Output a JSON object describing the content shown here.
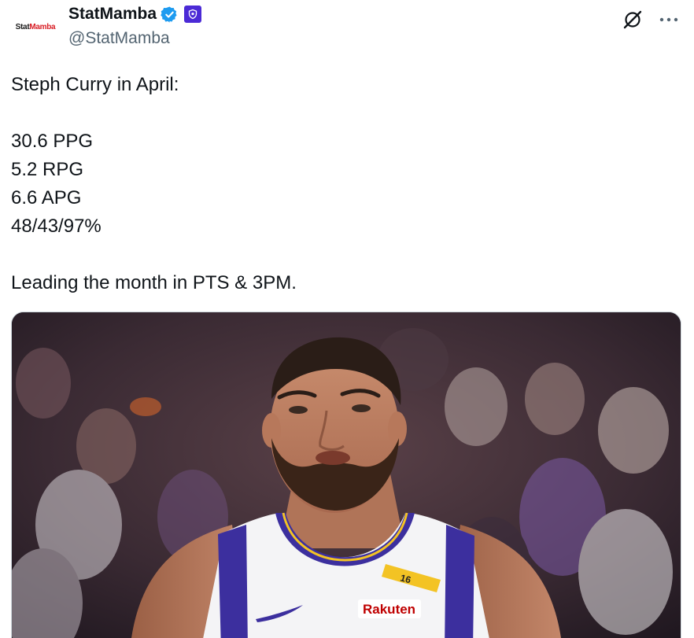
{
  "author": {
    "display_name": "StatMamba",
    "handle": "@StatMamba",
    "avatar_text_1": "Stat",
    "avatar_text_2": "Mamba",
    "verified": true,
    "verified_color": "#1d9bf0",
    "affiliate_badge_color": "#4b2ad6"
  },
  "actions": {
    "grok_icon": "grok-icon",
    "more_icon": "more-dots-icon"
  },
  "tweet": {
    "lines": [
      "Steph Curry in April:",
      "",
      "30.6 PPG",
      "5.2 RPG",
      "6.6 APG",
      "48/43/97%",
      "",
      "Leading the month in PTS & 3PM."
    ]
  },
  "media": {
    "jersey_number": "16",
    "jersey_sponsor": "Rakuten"
  }
}
